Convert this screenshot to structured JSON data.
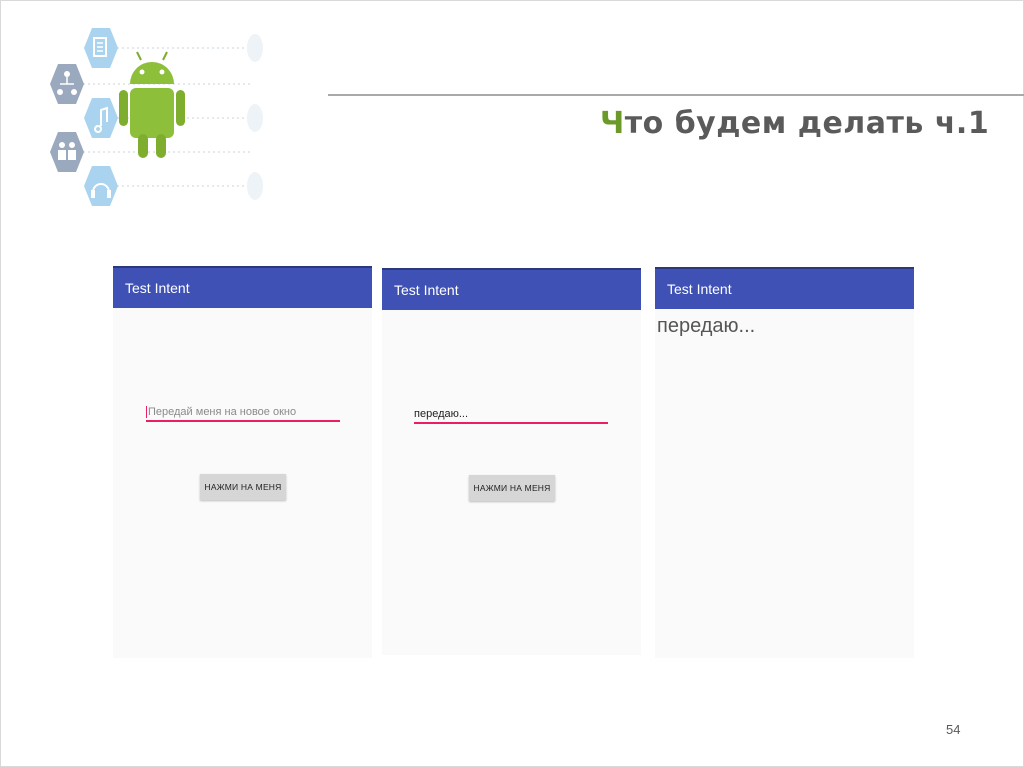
{
  "slide": {
    "title_accent": "Ч",
    "title_rest": "то будем делать ч.1",
    "page_number": "54"
  },
  "logo": {
    "icons": [
      "document-icon",
      "network-icon",
      "music-note-icon",
      "people-icon",
      "headphones-icon"
    ],
    "mascot": "android-robot"
  },
  "screens": [
    {
      "app_title": "Test Intent",
      "input_placeholder": "Передай меня на новое окно",
      "button_label": "НАЖМИ НА МЕНЯ"
    },
    {
      "app_title": "Test Intent",
      "input_value": "передаю...",
      "button_label": "НАЖМИ НА МЕНЯ"
    },
    {
      "app_title": "Test Intent",
      "received_text": "передаю..."
    }
  ],
  "colors": {
    "appbar": "#3f51b5",
    "input_underline": "#e91e63",
    "title_accent": "#6b9a2b",
    "title_text": "#5a5a5a"
  }
}
